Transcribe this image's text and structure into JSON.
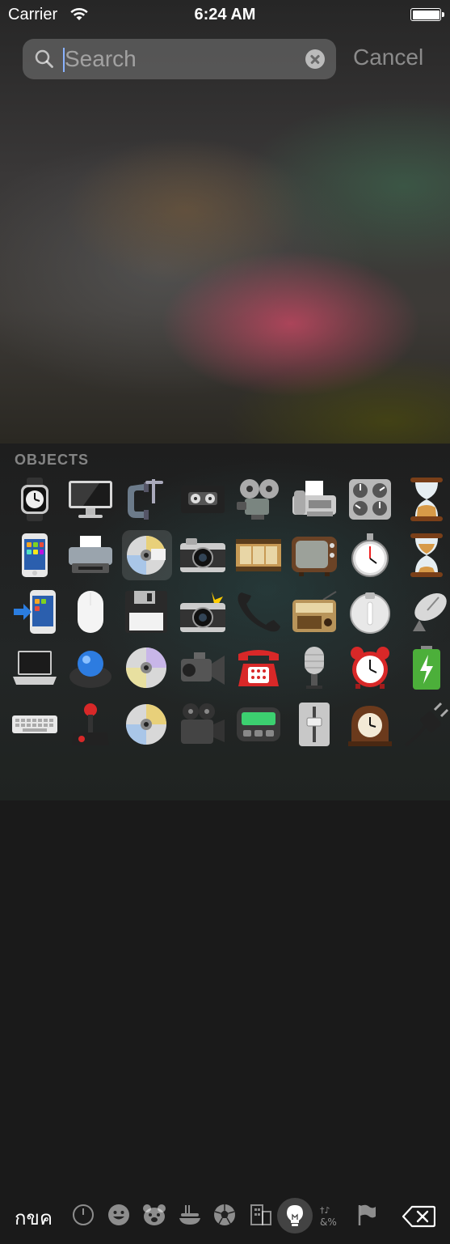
{
  "status_bar": {
    "carrier": "Carrier",
    "time": "6:24 AM"
  },
  "search": {
    "placeholder": "Search",
    "value": "",
    "cancel_label": "Cancel"
  },
  "keyboard": {
    "section_title": "OBJECTS",
    "keyboard_switch_label": "กขค",
    "emoji_grid": [
      [
        "watch",
        "desktop-computer",
        "clamp",
        "videocassette",
        "film-projector",
        "fax-machine",
        "control-knobs",
        "hourglass"
      ],
      [
        "mobile-phone",
        "printer",
        "optical-disk",
        "camera",
        "film-frames",
        "television",
        "stopwatch",
        "hourglass-flowing"
      ],
      [
        "mobile-phone-arrow",
        "computer-mouse",
        "floppy-disk",
        "camera-with-flash",
        "telephone-receiver",
        "radio",
        "timer-clock",
        "satellite-antenna"
      ],
      [
        "laptop",
        "trackball",
        "dvd",
        "video-camera",
        "telephone",
        "studio-microphone",
        "alarm-clock",
        "battery"
      ],
      [
        "keyboard",
        "joystick",
        "cd",
        "movie-camera",
        "pager",
        "level-slider",
        "mantelpiece-clock",
        "electric-plug"
      ]
    ],
    "selected_cell": "optical-disk",
    "category_icons": [
      "recent-clock-icon",
      "smiley-icon",
      "bear-icon",
      "food-icon",
      "soccer-ball-icon",
      "buildings-icon",
      "lightbulb-icon",
      "symbols-icon",
      "flag-icon"
    ],
    "active_category": "lightbulb-icon"
  }
}
